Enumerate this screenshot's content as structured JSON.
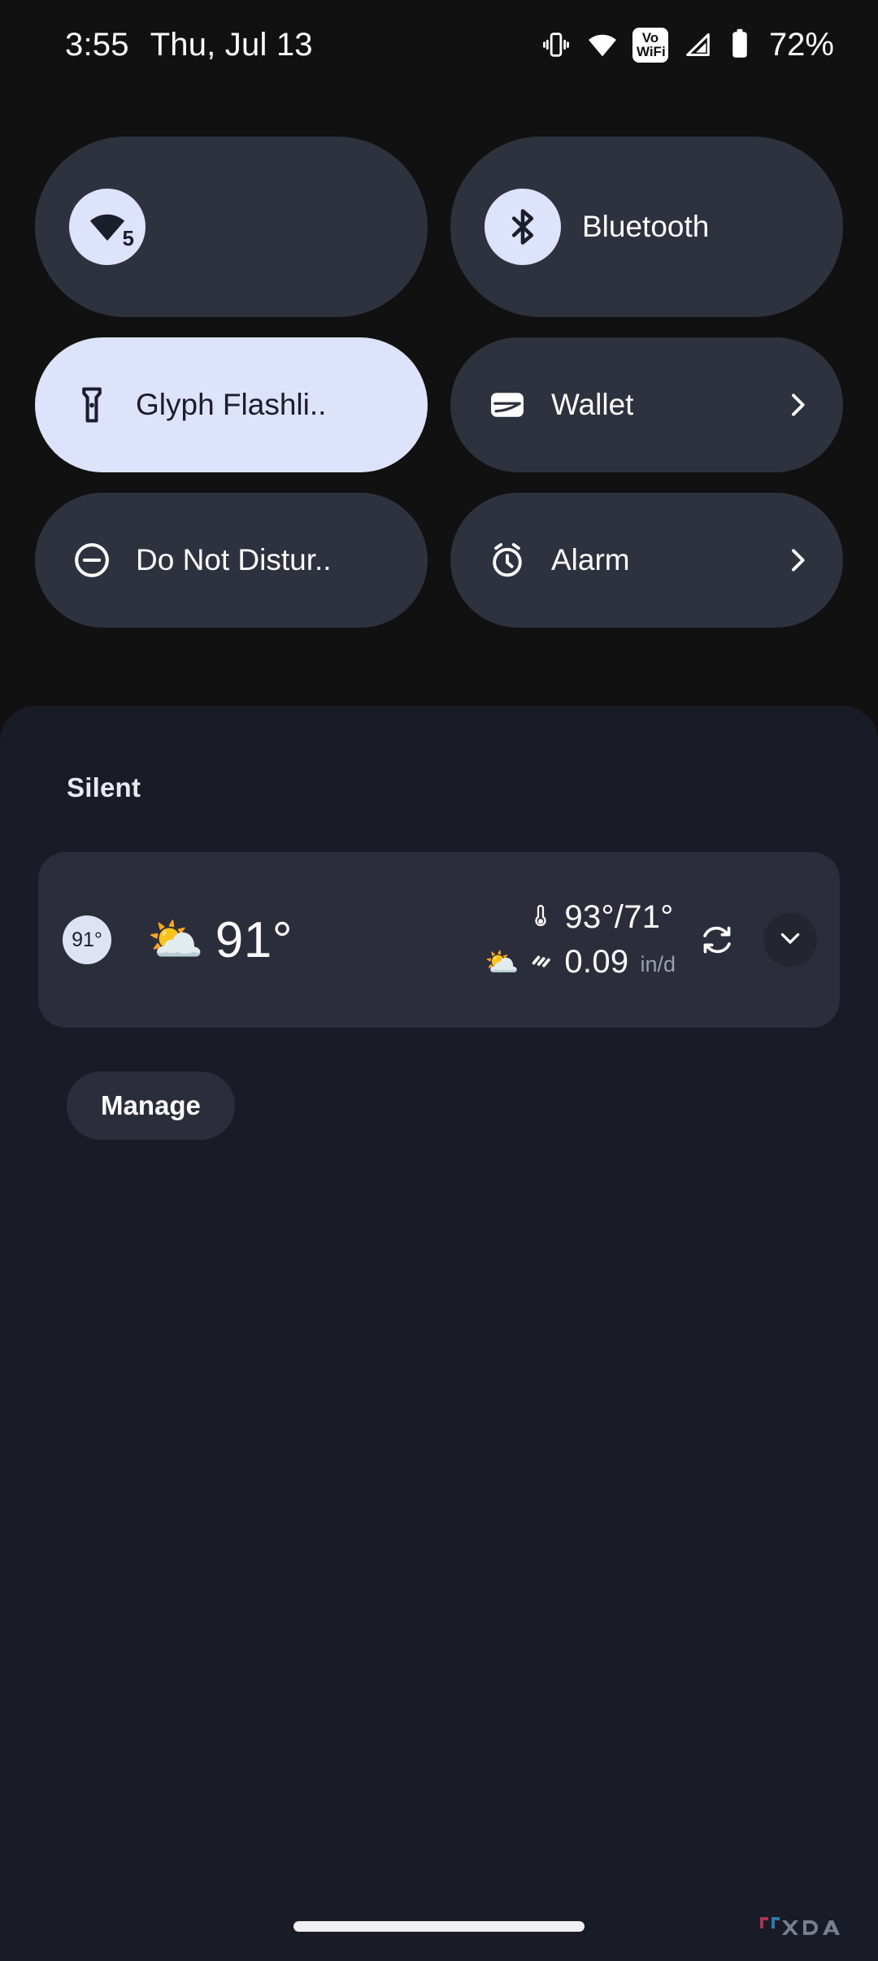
{
  "status_bar": {
    "time": "3:55",
    "date": "Thu, Jul 13",
    "battery_percent": "72%",
    "vowifi_line1": "Vo",
    "vowifi_line2": "WiFi",
    "icons": [
      "vibrate-icon",
      "wifi-icon",
      "vowifi-badge-icon",
      "cell-signal-icon",
      "battery-icon"
    ]
  },
  "quick_settings": {
    "tiles": [
      {
        "id": "wifi",
        "label": "",
        "icon": "wifi-icon",
        "badge": "5",
        "active": false,
        "icon_circle": true,
        "chevron": false
      },
      {
        "id": "bluetooth",
        "label": "Bluetooth",
        "icon": "bluetooth-icon",
        "active": false,
        "icon_circle": true,
        "chevron": false
      },
      {
        "id": "glyph-flashlight",
        "label": "Glyph Flashli..",
        "icon": "flashlight-icon",
        "active": true,
        "icon_circle": false,
        "chevron": false
      },
      {
        "id": "wallet",
        "label": "Wallet",
        "icon": "wallet-icon",
        "active": false,
        "icon_circle": false,
        "chevron": true
      },
      {
        "id": "do-not-disturb",
        "label": "Do Not Distur..",
        "icon": "do-not-disturb-icon",
        "active": false,
        "icon_circle": false,
        "chevron": false
      },
      {
        "id": "alarm",
        "label": "Alarm",
        "icon": "alarm-clock-icon",
        "active": false,
        "icon_circle": false,
        "chevron": true
      }
    ]
  },
  "notifications": {
    "section_header": "Silent",
    "weather": {
      "app_badge": "91°",
      "condition_emoji": "⛅",
      "current_temp": "91°",
      "high_low": "93°/71°",
      "precipitation": "0.09",
      "precipitation_unit": "in/d",
      "thermometer_icon": "thermometer-icon",
      "rain_icon": "rain-icon",
      "refresh_icon": "refresh-icon",
      "expand_icon": "chevron-down-icon"
    },
    "manage_label": "Manage"
  },
  "system_nav": {
    "gesture_handle": "home-gesture-pill",
    "watermark": "XDA"
  },
  "colors": {
    "screen_bg": "#111111",
    "shade_bg": "#191b26",
    "tile_inactive": "#2e323e",
    "tile_active": "#dee3fc",
    "accent_light": "#dee3fc",
    "card_bg": "#2b2e3a",
    "text_primary": "#ffffff",
    "text_secondary": "#9aa0b0"
  }
}
